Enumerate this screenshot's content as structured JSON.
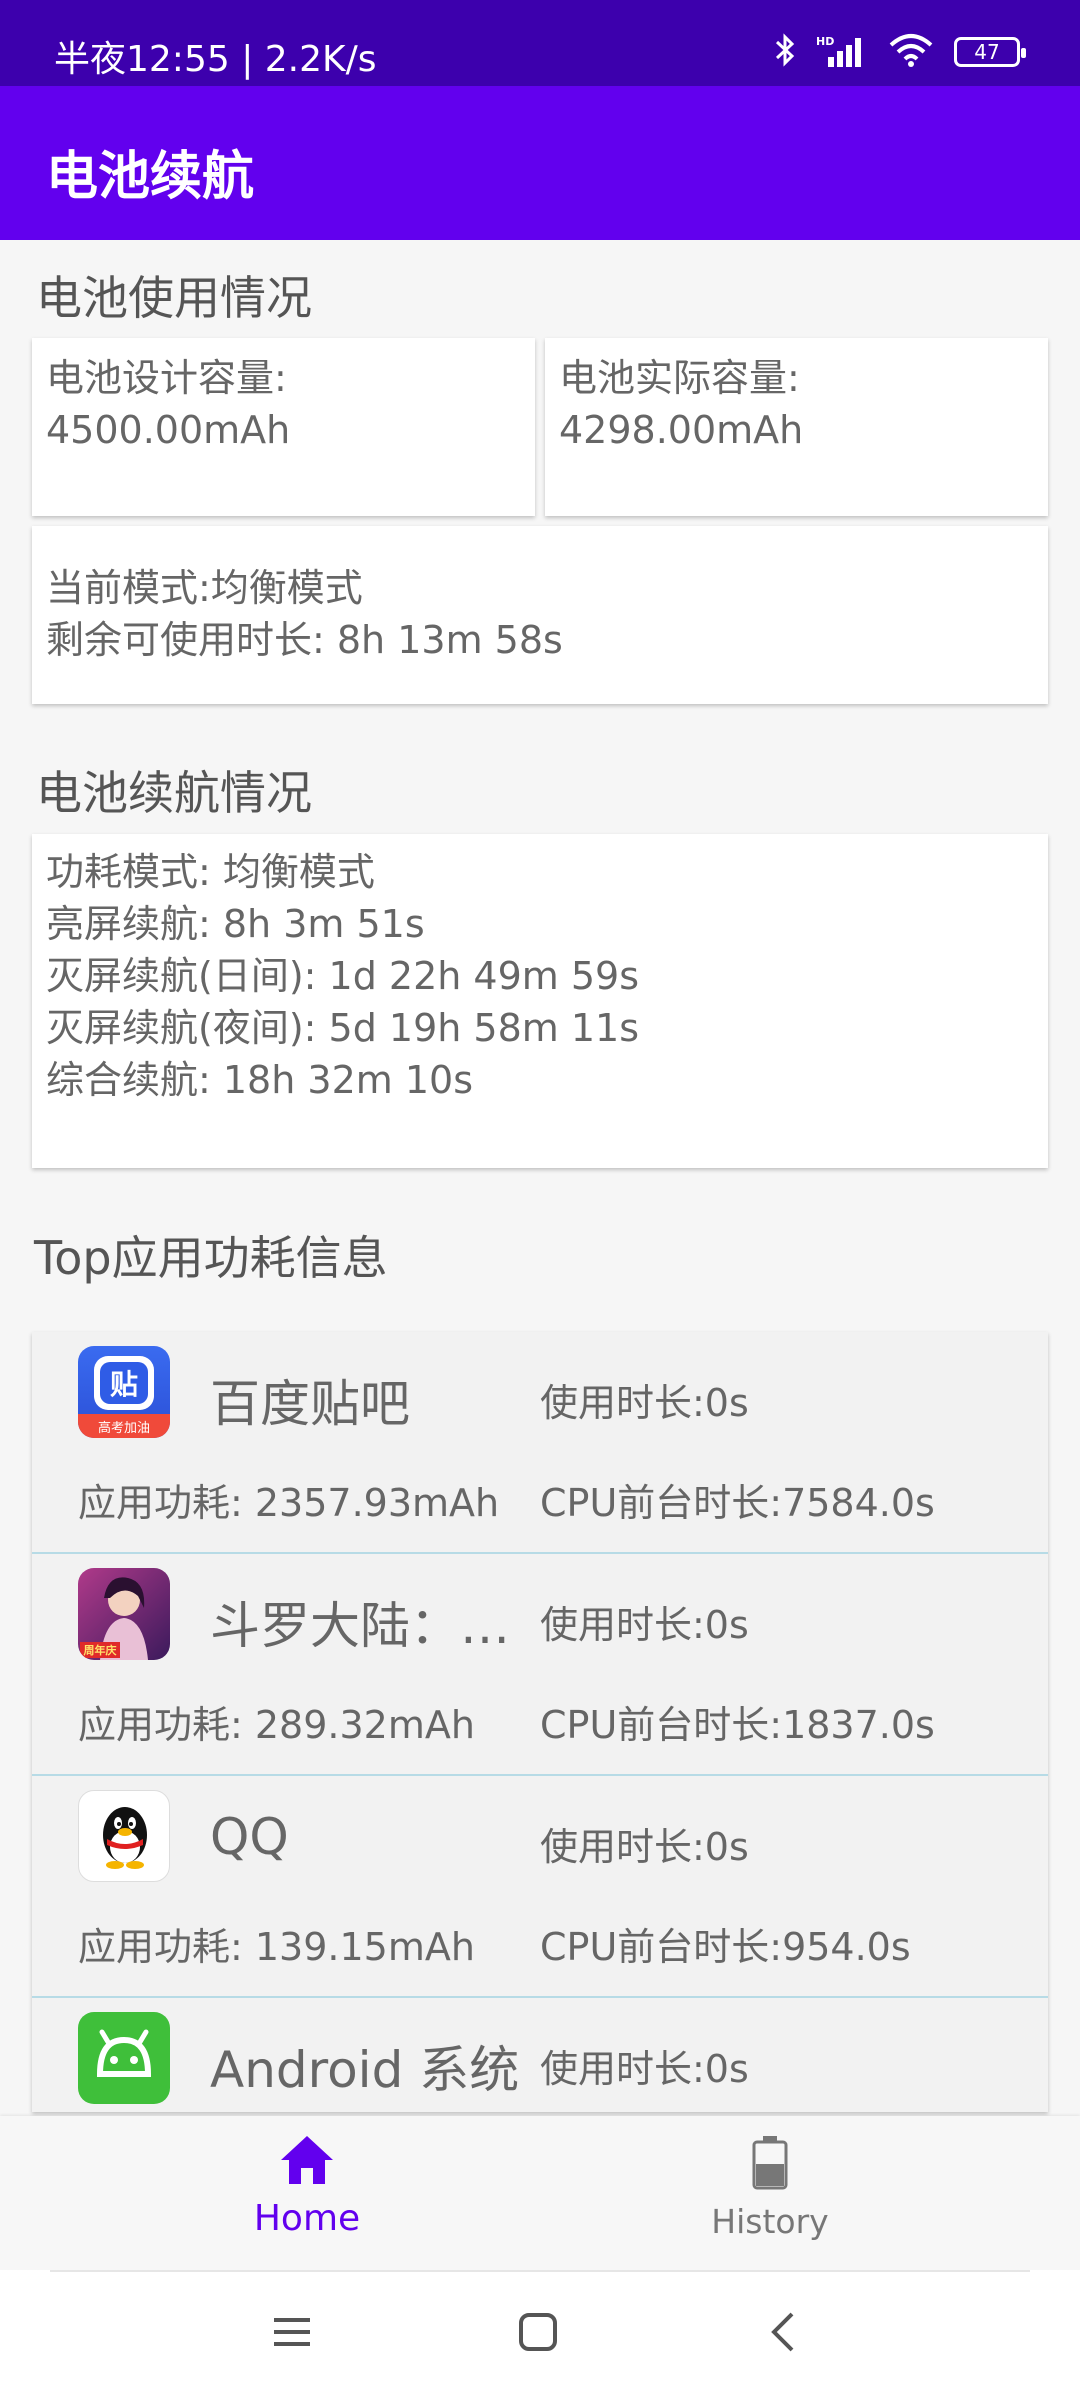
{
  "status_bar": {
    "time_speed": "半夜12:55 | 2.2K/s",
    "battery_level": "47",
    "icons": [
      "bluetooth-icon",
      "cellular-signal-icon",
      "wifi-icon",
      "battery-icon"
    ]
  },
  "app_bar": {
    "title": "电池续航"
  },
  "battery_usage": {
    "section_title": "电池使用情况",
    "design_capacity_label": "电池设计容量:",
    "design_capacity_value": "4500.00mAh",
    "actual_capacity_label": "电池实际容量:",
    "actual_capacity_value": "4298.00mAh",
    "current_mode": "当前模式:均衡模式",
    "remaining_time": "剩余可使用时长: 8h 13m 58s"
  },
  "battery_endurance": {
    "section_title": "电池续航情况",
    "lines": [
      "功耗模式: 均衡模式",
      "亮屏续航: 8h 3m 51s",
      "灭屏续航(日间): 1d 22h 49m 59s",
      "灭屏续航(夜间): 5d 19h 58m 11s",
      "综合续航: 18h 32m 10s"
    ]
  },
  "top_apps": {
    "section_title": "Top应用功耗信息",
    "apps": [
      {
        "name": "百度贴吧",
        "usage": "使用时长:0s",
        "power": "应用功耗: 2357.93mAh",
        "cpu": "CPU前台时长:7584.0s",
        "icon": "baidu-tieba-icon"
      },
      {
        "name": "斗罗大陆：魂师对决",
        "usage": "使用时长:0s",
        "power": "应用功耗: 289.32mAh",
        "cpu": "CPU前台时长:1837.0s",
        "icon": "douluo-game-icon"
      },
      {
        "name": "QQ",
        "usage": "使用时长:0s",
        "power": "应用功耗: 139.15mAh",
        "cpu": "CPU前台时长:954.0s",
        "icon": "qq-penguin-icon"
      },
      {
        "name": "Android 系统",
        "usage": "使用时长:0s",
        "power": "",
        "cpu": "",
        "icon": "android-system-icon"
      }
    ]
  },
  "bottom_nav": {
    "items": [
      {
        "label": "Home",
        "icon": "home-icon",
        "active": true
      },
      {
        "label": "History",
        "icon": "battery-history-icon",
        "active": false
      }
    ]
  },
  "colors": {
    "status_bar": "#3d00ad",
    "app_bar": "#6200ee",
    "active_nav": "#6200ee",
    "divider": "#b7dbe6"
  }
}
